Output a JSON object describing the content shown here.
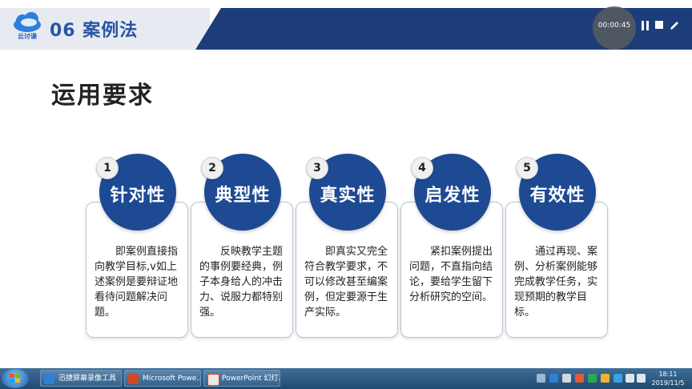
{
  "slide": {
    "logo_text": "云讨课",
    "title": "06 案例法",
    "heading": "运用要求",
    "items": [
      {
        "number": "1",
        "label": "针对性",
        "text": "即案例直接指向教学目标,v如上述案例是要辩证地看待问题解决问题。"
      },
      {
        "number": "2",
        "label": "典型性",
        "text": "反映教学主题的事例要经典，例子本身给人的冲击力、说服力都特别强。"
      },
      {
        "number": "3",
        "label": "真实性",
        "text": "即真实又完全符合教学要求，不可以修改甚至编案例，但定要源于生产实际。"
      },
      {
        "number": "4",
        "label": "启发性",
        "text": "紧扣案例提出问题，不直指向结论，要给学生留下分析研究的空间。"
      },
      {
        "number": "5",
        "label": "有效性",
        "text": "通过再现、案例、分析案例能够完成教学任务，实现预期的教学目标。"
      }
    ],
    "colors": {
      "accent": "#1d4a93",
      "header_band": "#1d3d7a",
      "title": "#2a55a5"
    }
  },
  "recorder": {
    "time": "00:00:45",
    "pause_icon": "pause-icon",
    "stop_icon": "stop-icon",
    "pen_icon": "pen-icon"
  },
  "taskbar": {
    "tasks": [
      {
        "label": "迅捷屏幕录像工具",
        "icon": "recorder-app-icon"
      },
      {
        "label": "Microsoft Powe...",
        "icon": "powerpoint-icon"
      },
      {
        "label": "PowerPoint 幻灯...",
        "icon": "powerpoint-slideshow-icon"
      }
    ],
    "clock_time": "18:11",
    "clock_date": "2019/11/5"
  }
}
